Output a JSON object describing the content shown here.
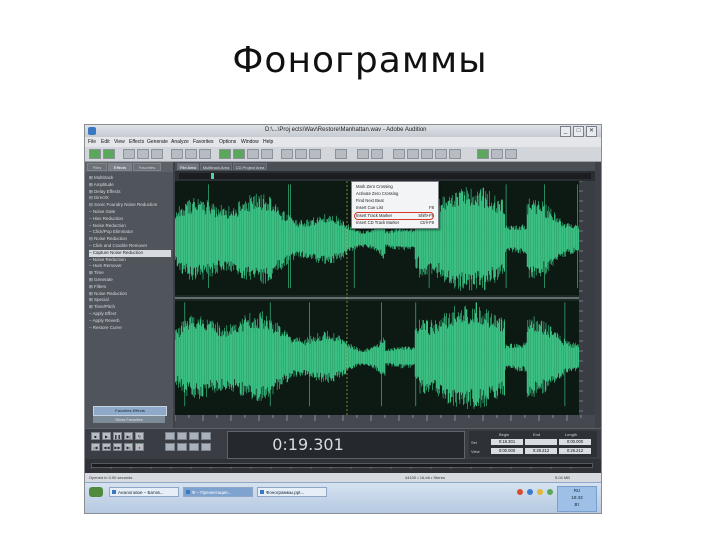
{
  "slide": {
    "title": "Фонограммы"
  },
  "window": {
    "title": "D:\\...\\Proj ects\\Wav\\Restore\\Manhattan.wav - Adobe Audition",
    "min": "_",
    "max": "□",
    "close": "✕"
  },
  "menu": [
    "File",
    "Edit",
    "View",
    "Effects",
    "Generate",
    "Analyze",
    "Favorites",
    "Options",
    "Window",
    "Help"
  ],
  "left_panel": {
    "tabs": [
      "Files",
      "Effects",
      "Favorites"
    ],
    "tree": [
      "⊞ Multitrack",
      "⊞ Amplitude",
      "⊞ Delay Effects",
      "⊟ DirectX",
      "  ⊟ Sonic Foundry Noise Reduction",
      "    – Noise Gate",
      "    – Hiss Reduction",
      "    – Noise Reduction",
      "    – Click/Pop Eliminator",
      "  ⊟ Noise Reduction",
      "    – Click and Crackle Remover",
      "    – Capture Noise Reduction",
      "    – Noise Reduction",
      "    – Hum Remover",
      "⊞ Time",
      "⊞ Generate",
      "⊞ Filters",
      "⊞ Noise Reduction",
      "⊞ Special",
      "⊞ Time/Pitch",
      "  – Apply Effect",
      "  – Apply Reverb",
      "  – Restore Curve"
    ],
    "highlight_index": 11,
    "buttons": [
      "Favorites Effects",
      "Show Favorites"
    ]
  },
  "editor": {
    "tabs": [
      "File Area",
      "Multitrack Area",
      "CD Project Area"
    ],
    "context_menu": [
      {
        "label": "Mark Zero Crossing",
        "shortcut": ""
      },
      {
        "label": "Activate Zero Crossing",
        "shortcut": ""
      },
      {
        "label": "Find Next Beat",
        "shortcut": ""
      },
      {
        "label": "Insert Cue List",
        "shortcut": "F8"
      },
      {
        "label": "Insert Track Marker",
        "shortcut": "Shift+F8"
      },
      {
        "label": "Insert CD Track Marker",
        "shortcut": "Ctrl+F8"
      }
    ],
    "circled_index": 4
  },
  "transport": {
    "time": "0:19.301",
    "sel_headers": [
      "Begin",
      "End",
      "Length"
    ],
    "sel_rows": [
      {
        "label": "Sel",
        "values": [
          "0:18.301",
          "",
          "0:00.000"
        ]
      },
      {
        "label": "View",
        "values": [
          "0:00.000",
          "0:29.212",
          "0:29.212"
        ]
      }
    ]
  },
  "statusbar": {
    "left": "Opened in 0.00 seconds",
    "mid": "44100 • 16-bit • Stereo",
    "right": "5.04 MB"
  },
  "taskbar": {
    "items": [
      "Аналоговое – Батов...",
      "Ф – Презентация...",
      "Фонограммы.ppt..."
    ],
    "active_index": 1,
    "clock": [
      "RU",
      "18:43",
      "Вт"
    ]
  },
  "colors": {
    "wave": "#3fd38f",
    "wave_bg": "#0d1a14",
    "accent_circle": "#d43a2a"
  }
}
